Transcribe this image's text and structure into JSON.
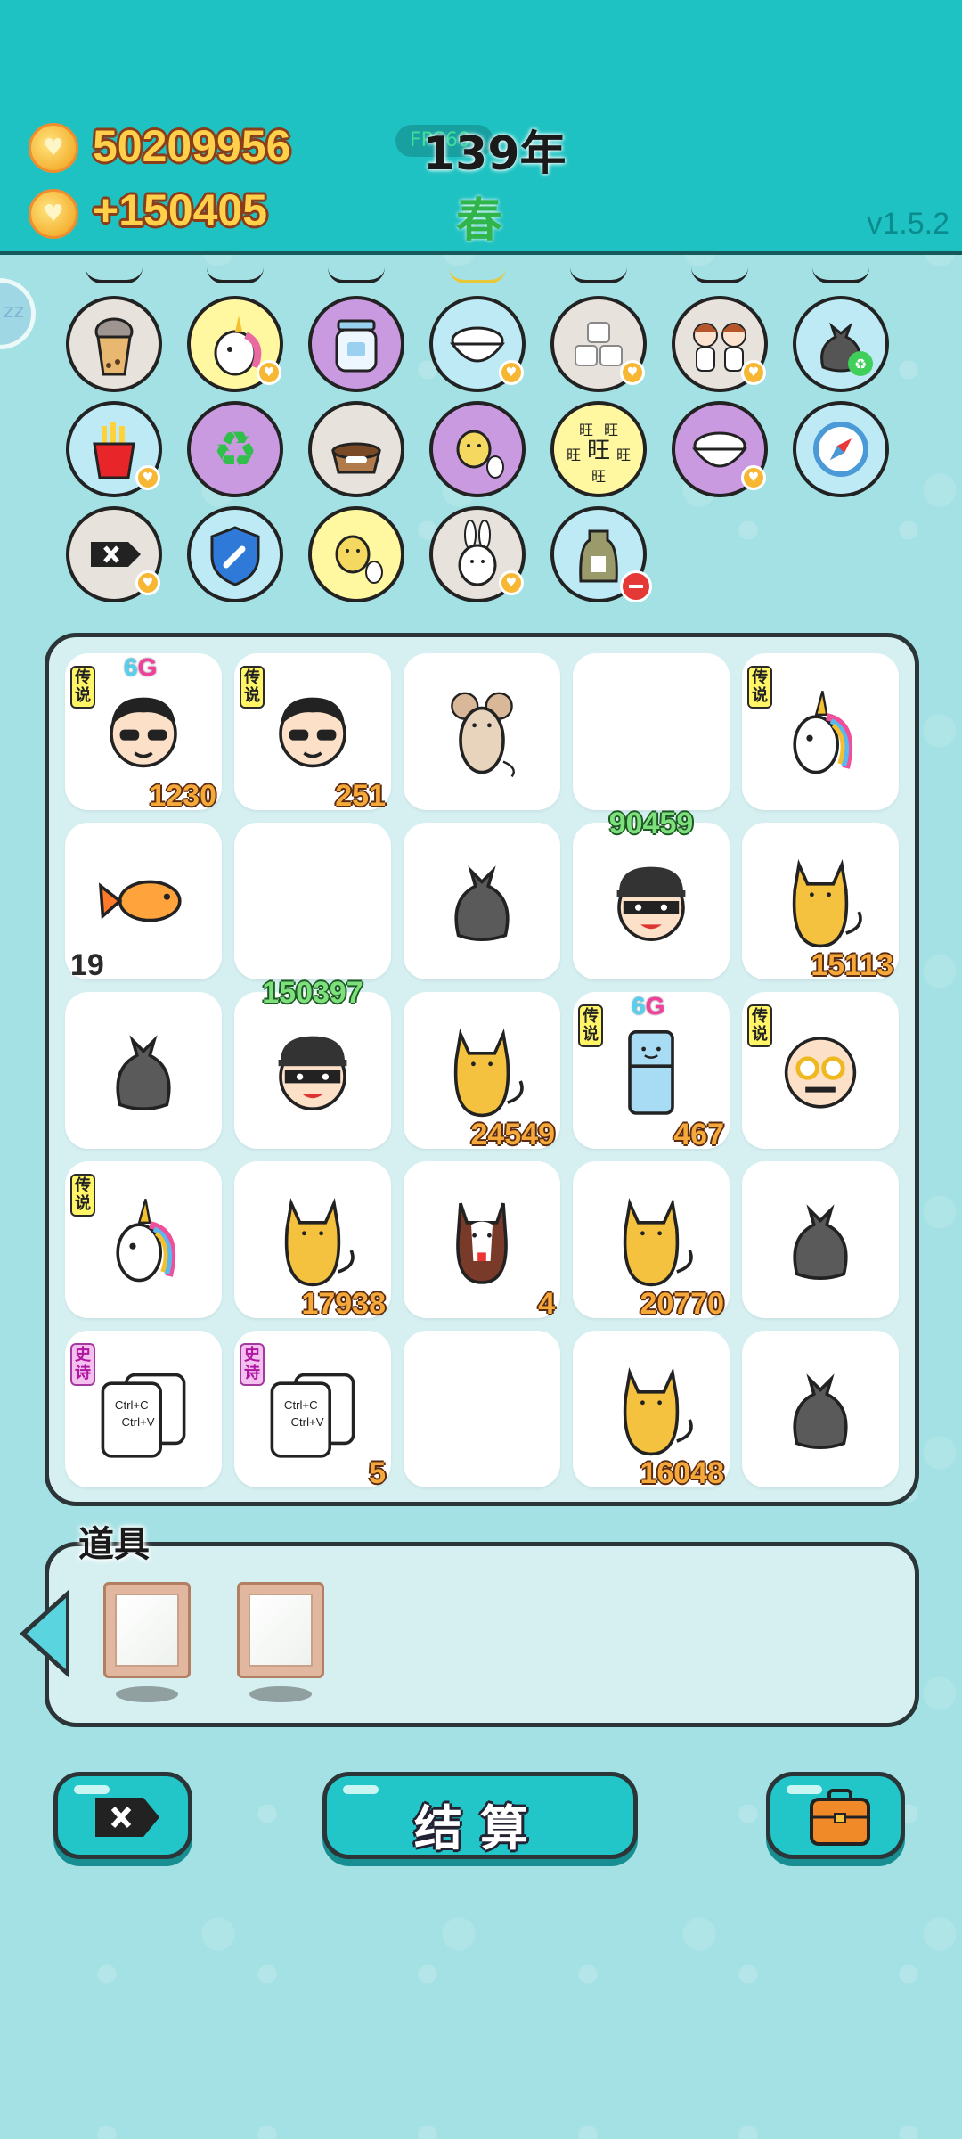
{
  "header": {
    "coins_total": "50209956",
    "coins_rate": "+150405",
    "fps_badge": "FPS60",
    "year": "139年",
    "season": "春",
    "version": "v1.5.2"
  },
  "side_button_label": "zz",
  "items": [
    {
      "icon": "bubble-tea-icon",
      "bg": "gray",
      "badge": null
    },
    {
      "icon": "unicorn-icon",
      "bg": "yellow",
      "badge": "heart"
    },
    {
      "icon": "jar-icon",
      "bg": "purple",
      "badge": null
    },
    {
      "icon": "rice-bowl-icon",
      "bg": "blue",
      "badge": "heart"
    },
    {
      "icon": "sugar-cubes-icon",
      "bg": "gray",
      "badge": "heart"
    },
    {
      "icon": "twins-icon",
      "bg": "gray",
      "badge": "heart"
    },
    {
      "icon": "recycle-bag-icon",
      "bg": "blue",
      "badge": null
    },
    {
      "icon": "fries-icon",
      "bg": "blue",
      "badge": "heart"
    },
    {
      "icon": "recycle-icon",
      "bg": "purple",
      "badge": null
    },
    {
      "icon": "pet-food-icon",
      "bg": "gray",
      "badge": null
    },
    {
      "icon": "chick-egg-icon",
      "bg": "purple",
      "badge": null
    },
    {
      "icon": "wangwang-icon",
      "bg": "yellow",
      "badge": null
    },
    {
      "icon": "rice-bowl-icon",
      "bg": "purple",
      "badge": "heart"
    },
    {
      "icon": "compass-icon",
      "bg": "blue",
      "badge": null
    },
    {
      "icon": "delete-key-icon",
      "bg": "gray",
      "badge": "heart"
    },
    {
      "icon": "shield-wrench-icon",
      "bg": "blue",
      "badge": null
    },
    {
      "icon": "chick-egg-icon",
      "bg": "yellow",
      "badge": null
    },
    {
      "icon": "rabbit-icon",
      "bg": "gray",
      "badge": "heart"
    },
    {
      "icon": "sack-icon",
      "bg": "blue",
      "badge": "minus"
    }
  ],
  "board": [
    {
      "icon": "sunglasses-man-icon",
      "tag": "传说",
      "sixg": true,
      "num": "1230",
      "num_pos": "br"
    },
    {
      "icon": "sunglasses-man-icon",
      "tag": "传说",
      "num": "251",
      "num_pos": "br"
    },
    {
      "icon": "mouse-icon"
    },
    {
      "icon": null
    },
    {
      "icon": "unicorn-icon",
      "tag": "传说"
    },
    {
      "icon": "fish-icon",
      "num": "19",
      "num_pos": "bl"
    },
    {
      "icon": null
    },
    {
      "icon": "trash-bag-icon"
    },
    {
      "icon": "thief-icon",
      "num": "90459",
      "num_pos": "green"
    },
    {
      "icon": "cat-icon",
      "num": "15113",
      "num_pos": "br"
    },
    {
      "icon": "trash-bag-icon"
    },
    {
      "icon": "thief-icon",
      "num": "150397",
      "num_pos": "green"
    },
    {
      "icon": "cat-icon",
      "num": "24549",
      "num_pos": "br"
    },
    {
      "icon": "fridge-icon",
      "tag": "传说",
      "sixg": true,
      "num": "467",
      "num_pos": "br"
    },
    {
      "icon": "old-man-glasses-icon",
      "tag": "传说"
    },
    {
      "icon": "unicorn-icon",
      "tag": "传说"
    },
    {
      "icon": "cat-icon",
      "num": "17938",
      "num_pos": "br"
    },
    {
      "icon": "husky-dog-icon",
      "num": "4",
      "num_pos": "br"
    },
    {
      "icon": "cat-icon",
      "num": "20770",
      "num_pos": "br"
    },
    {
      "icon": "trash-bag-icon"
    },
    {
      "icon": "copy-paste-icon",
      "tag": "史诗",
      "tag_type": "epic"
    },
    {
      "icon": "copy-paste-icon",
      "tag": "史诗",
      "tag_type": "epic",
      "num": "5",
      "num_pos": "br"
    },
    {
      "icon": null
    },
    {
      "icon": "cat-icon",
      "num": "16048",
      "num_pos": "br"
    },
    {
      "icon": "trash-bag-icon"
    }
  ],
  "sixg_text": {
    "a": "6",
    "b": "G"
  },
  "copy_paste_text": {
    "line1": "Ctrl+C",
    "line2": "Ctrl+V"
  },
  "wangwang_char": "旺",
  "props": {
    "title": "道具",
    "slots": [
      "picture-frame-icon",
      "picture-frame-icon"
    ]
  },
  "buttons": {
    "settle_label": "结算",
    "delete_icon": "delete-key-icon",
    "bag_icon": "briefcase-icon"
  },
  "colors": {
    "header_bg": "#1fc2c2",
    "page_bg": "#a4e1e4",
    "button_bg": "#22c6c8",
    "gold_text": "#ffd04a",
    "green_num": "#7de07d"
  }
}
